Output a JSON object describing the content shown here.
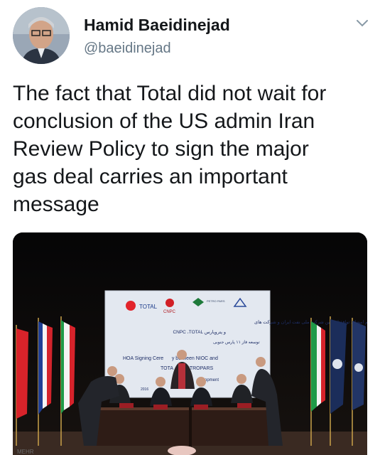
{
  "author": {
    "name": "Hamid Baeidinejad",
    "handle": "@baeidinejad"
  },
  "tweet": {
    "lines": [
      "The fact that Total did not wait for",
      "conclusion of the US admin Iran",
      "Review Policy to sign the major",
      "gas deal carries an important",
      "message"
    ]
  },
  "photo": {
    "banner": {
      "logo_total": "TOTAL",
      "logo_cnpc": "CNPC",
      "logo_petropars": "PETRO PARS",
      "fa_line1": "مراسم امضای توافقنامه بین شرکت ملی نفت ایران و شرکت های",
      "fa_line2": "CNPC ،TOTAL و پتروپارس",
      "fa_line3": "توسعه فاز ۱۱ پارس جنوبی",
      "en_line1": "HOA Signing Cere      y between NIOC and",
      "en_line2": "TOTA            TROPARS",
      "en_line3": "opment",
      "year": "2016"
    },
    "corner_text": "MEHR"
  },
  "colors": {
    "text_primary": "#14171a",
    "text_secondary": "#657786",
    "banner_bg": "#e3e8f0"
  }
}
